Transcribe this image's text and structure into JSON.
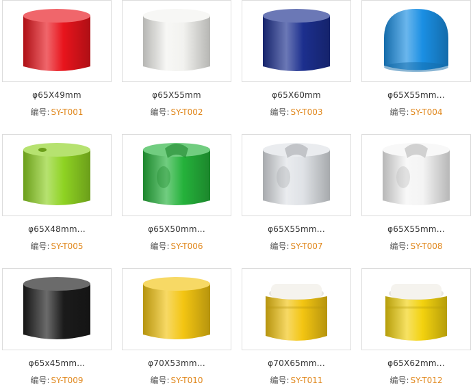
{
  "products": [
    {
      "name": "φ65X49mm",
      "code_label": "编号:",
      "code": "SY-T001",
      "color": "#e8141c",
      "shape": "cyl"
    },
    {
      "name": "φ65X55mm",
      "code_label": "编号:",
      "code": "SY-T002",
      "color": "#f2f2ef",
      "shape": "cyl"
    },
    {
      "name": "φ65X60mm",
      "code_label": "编号:",
      "code": "SY-T003",
      "color": "#1c2f8e",
      "shape": "cyl"
    },
    {
      "name": "φ65X55mm...",
      "code_label": "编号:",
      "code": "SY-T004",
      "color": "#1a8fe3",
      "shape": "dome"
    },
    {
      "name": "φ65X48mm...",
      "code_label": "编号:",
      "code": "SY-T005",
      "color": "#8fd323",
      "shape": "cylhole"
    },
    {
      "name": "φ65X50mm...",
      "code_label": "编号:",
      "code": "SY-T006",
      "color": "#25b23b",
      "shape": "notch"
    },
    {
      "name": "φ65X55mm...",
      "code_label": "编号:",
      "code": "SY-T007",
      "color": "#dfe2e6",
      "shape": "notch"
    },
    {
      "name": "φ65X55mm...",
      "code_label": "编号:",
      "code": "SY-T008",
      "color": "#f4f4f4",
      "shape": "notch"
    },
    {
      "name": "φ65x45mm...",
      "code_label": "编号:",
      "code": "SY-T009",
      "color": "#1b1b1b",
      "shape": "cyl"
    },
    {
      "name": "φ70X53mm...",
      "code_label": "编号:",
      "code": "SY-T010",
      "color": "#f3c512",
      "shape": "cyl"
    },
    {
      "name": "φ70X65mm...",
      "code_label": "编号:",
      "code": "SY-T011",
      "color": "#f3c512",
      "shape": "valve"
    },
    {
      "name": "φ65X62mm...",
      "code_label": "编号:",
      "code": "SY-T012",
      "color": "#f3d20f",
      "shape": "valve"
    }
  ]
}
